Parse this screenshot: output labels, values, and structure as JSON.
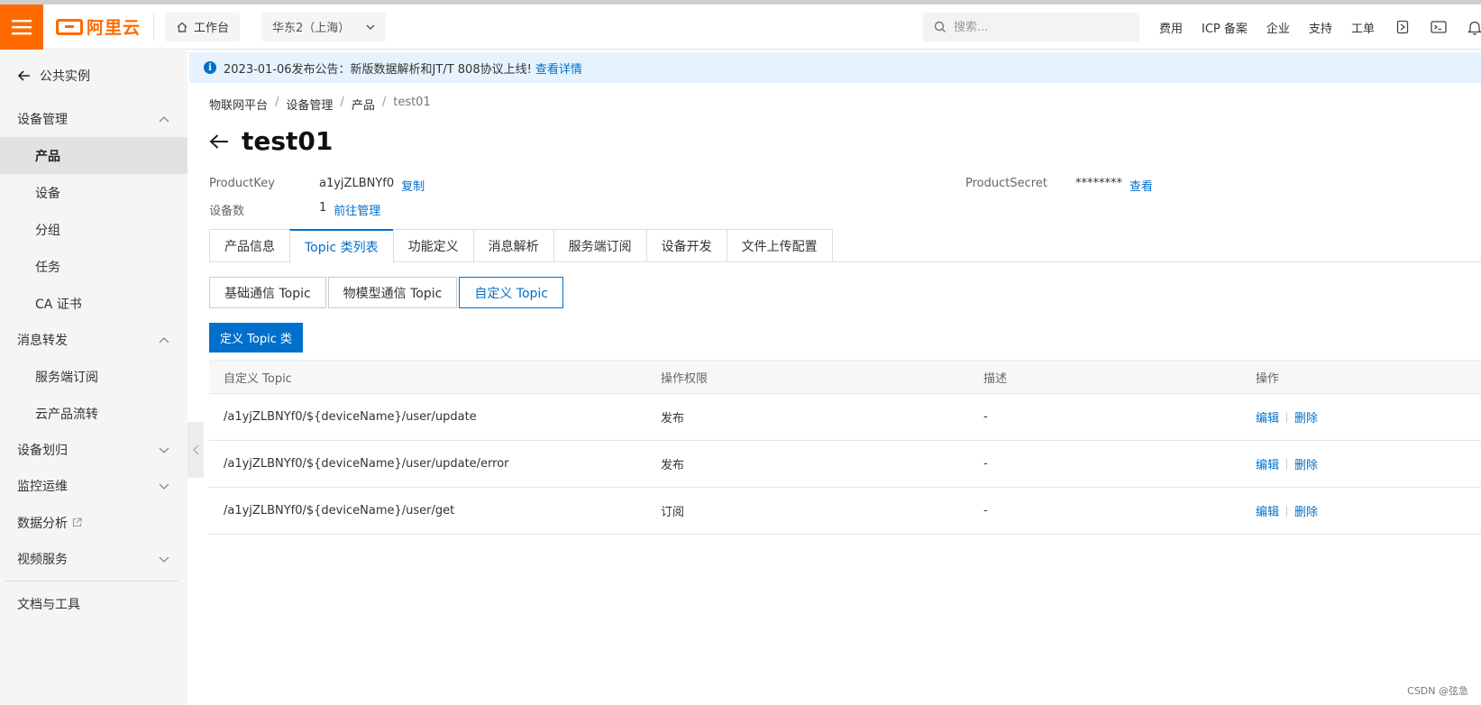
{
  "topbar": {
    "logo_text": "阿里云",
    "workbench": "工作台",
    "region": "华东2（上海）",
    "search_placeholder": "搜索...",
    "links": [
      "费用",
      "ICP 备案",
      "企业",
      "支持",
      "工单"
    ],
    "accent": "#ff6a00"
  },
  "sidebar": {
    "back_label": "公共实例",
    "groups": [
      {
        "label": "设备管理",
        "expanded": true,
        "items": [
          "产品",
          "设备",
          "分组",
          "任务",
          "CA 证书"
        ],
        "active": "产品"
      },
      {
        "label": "消息转发",
        "expanded": true,
        "items": [
          "服务端订阅",
          "云产品流转"
        ]
      },
      {
        "label": "设备划归",
        "expanded": false
      },
      {
        "label": "监控运维",
        "expanded": false
      },
      {
        "label": "数据分析",
        "external": true
      },
      {
        "label": "视频服务",
        "expanded": false
      }
    ],
    "footer_link": "文档与工具"
  },
  "notice": {
    "text": "2023-01-06发布公告：新版数据解析和JT/T 808协议上线!",
    "link": "查看详情"
  },
  "breadcrumb": [
    "物联网平台",
    "设备管理",
    "产品",
    "test01"
  ],
  "page": {
    "title": "test01",
    "product_key_label": "ProductKey",
    "product_key": "a1yjZLBNYf0",
    "copy_label": "复制",
    "product_secret_label": "ProductSecret",
    "product_secret": "********",
    "view_label": "查看",
    "device_count_label": "设备数",
    "device_count": "1",
    "manage_label": "前往管理"
  },
  "tabs": [
    "产品信息",
    "Topic 类列表",
    "功能定义",
    "消息解析",
    "服务端订阅",
    "设备开发",
    "文件上传配置"
  ],
  "active_tab": "Topic 类列表",
  "subtabs": [
    "基础通信 Topic",
    "物模型通信 Topic",
    "自定义 Topic"
  ],
  "active_subtab": "自定义 Topic",
  "define_button": "定义 Topic 类",
  "table": {
    "headers": [
      "自定义 Topic",
      "操作权限",
      "描述",
      "操作"
    ],
    "rows": [
      {
        "topic": "/a1yjZLBNYf0/${deviceName}/user/update",
        "perm": "发布",
        "desc": "-",
        "edit": "编辑",
        "delete": "删除"
      },
      {
        "topic": "/a1yjZLBNYf0/${deviceName}/user/update/error",
        "perm": "发布",
        "desc": "-",
        "edit": "编辑",
        "delete": "删除"
      },
      {
        "topic": "/a1yjZLBNYf0/${deviceName}/user/get",
        "perm": "订阅",
        "desc": "-",
        "edit": "编辑",
        "delete": "删除"
      }
    ]
  },
  "watermark": "CSDN @弦急"
}
